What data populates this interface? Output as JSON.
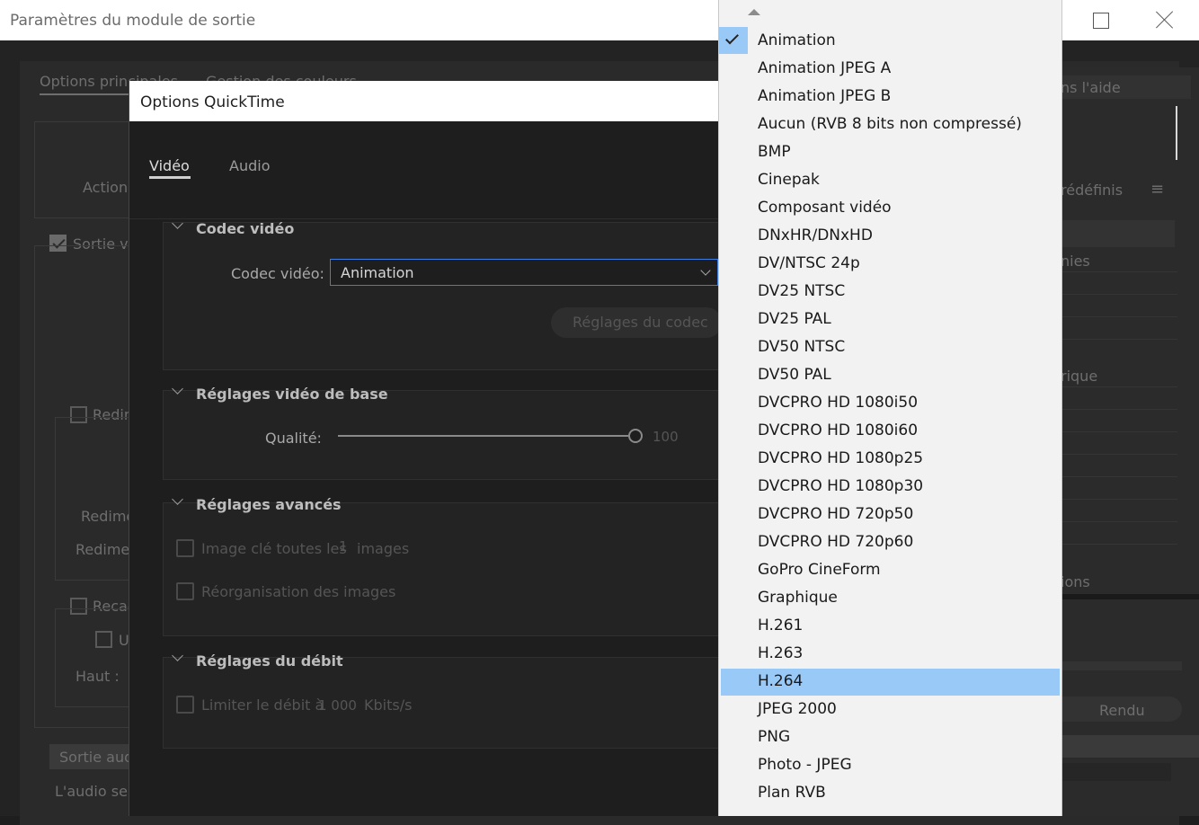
{
  "background_window": {
    "title": "Paramètres du module de sortie",
    "tabs": [
      "Options principales",
      "Gestion des couleurs"
    ],
    "labels": {
      "action": "Action",
      "video_output": "Sortie vidéo",
      "resize": "Redim",
      "resize_a": "Redime",
      "resize_b": "Redimer",
      "crop": "Recad",
      "crop_u": "U",
      "top": "Haut :",
      "audio_output": "Sortie audio",
      "audio_note": "L'audio ser"
    },
    "right_panel": {
      "help": "ns l'aide",
      "presets": "rédéfinis",
      "defined": "nies",
      "rique": "rique",
      "options": "ions",
      "render_button": "Rendu"
    }
  },
  "quicktime_dialog": {
    "title": "Options QuickTime",
    "tabs": [
      {
        "label": "Vidéo",
        "active": true
      },
      {
        "label": "Audio",
        "active": false
      }
    ],
    "sections": {
      "codec": {
        "title": "Codec vidéo",
        "codec_label": "Codec vidéo:",
        "codec_value": "Animation",
        "codec_settings_button": "Réglages du codec"
      },
      "basic": {
        "title": "Réglages vidéo de base",
        "quality_label": "Qualité:",
        "quality_value": "100",
        "quality": 100
      },
      "advanced": {
        "title": "Réglages avancés",
        "keyframe_label_a": "Image clé toutes les",
        "keyframe_value": "1",
        "keyframe_label_b": "images",
        "reorder_label": "Réorganisation des images"
      },
      "bitrate": {
        "title": "Réglages du débit",
        "limit_label": "Limiter le débit à",
        "limit_value": "1 000",
        "limit_unit": "Kbits/s"
      }
    }
  },
  "dropdown": {
    "checked_item": "Animation",
    "highlighted_item": "H.264",
    "items": [
      "Animation",
      "Animation JPEG A",
      "Animation JPEG B",
      "Aucun (RVB 8 bits non compressé)",
      "BMP",
      "Cinepak",
      "Composant vidéo",
      "DNxHR/DNxHD",
      "DV/NTSC 24p",
      "DV25 NTSC",
      "DV25 PAL",
      "DV50 NTSC",
      "DV50 PAL",
      "DVCPRO HD 1080i50",
      "DVCPRO HD 1080i60",
      "DVCPRO HD 1080p25",
      "DVCPRO HD 1080p30",
      "DVCPRO HD 720p50",
      "DVCPRO HD 720p60",
      "GoPro CineForm",
      "Graphique",
      "H.261",
      "H.263",
      "H.264",
      "JPEG 2000",
      "PNG",
      "Photo - JPEG",
      "Plan RVB"
    ]
  },
  "colors": {
    "accent_blue": "#3c7be0",
    "selection_blue": "#99c9f7"
  }
}
